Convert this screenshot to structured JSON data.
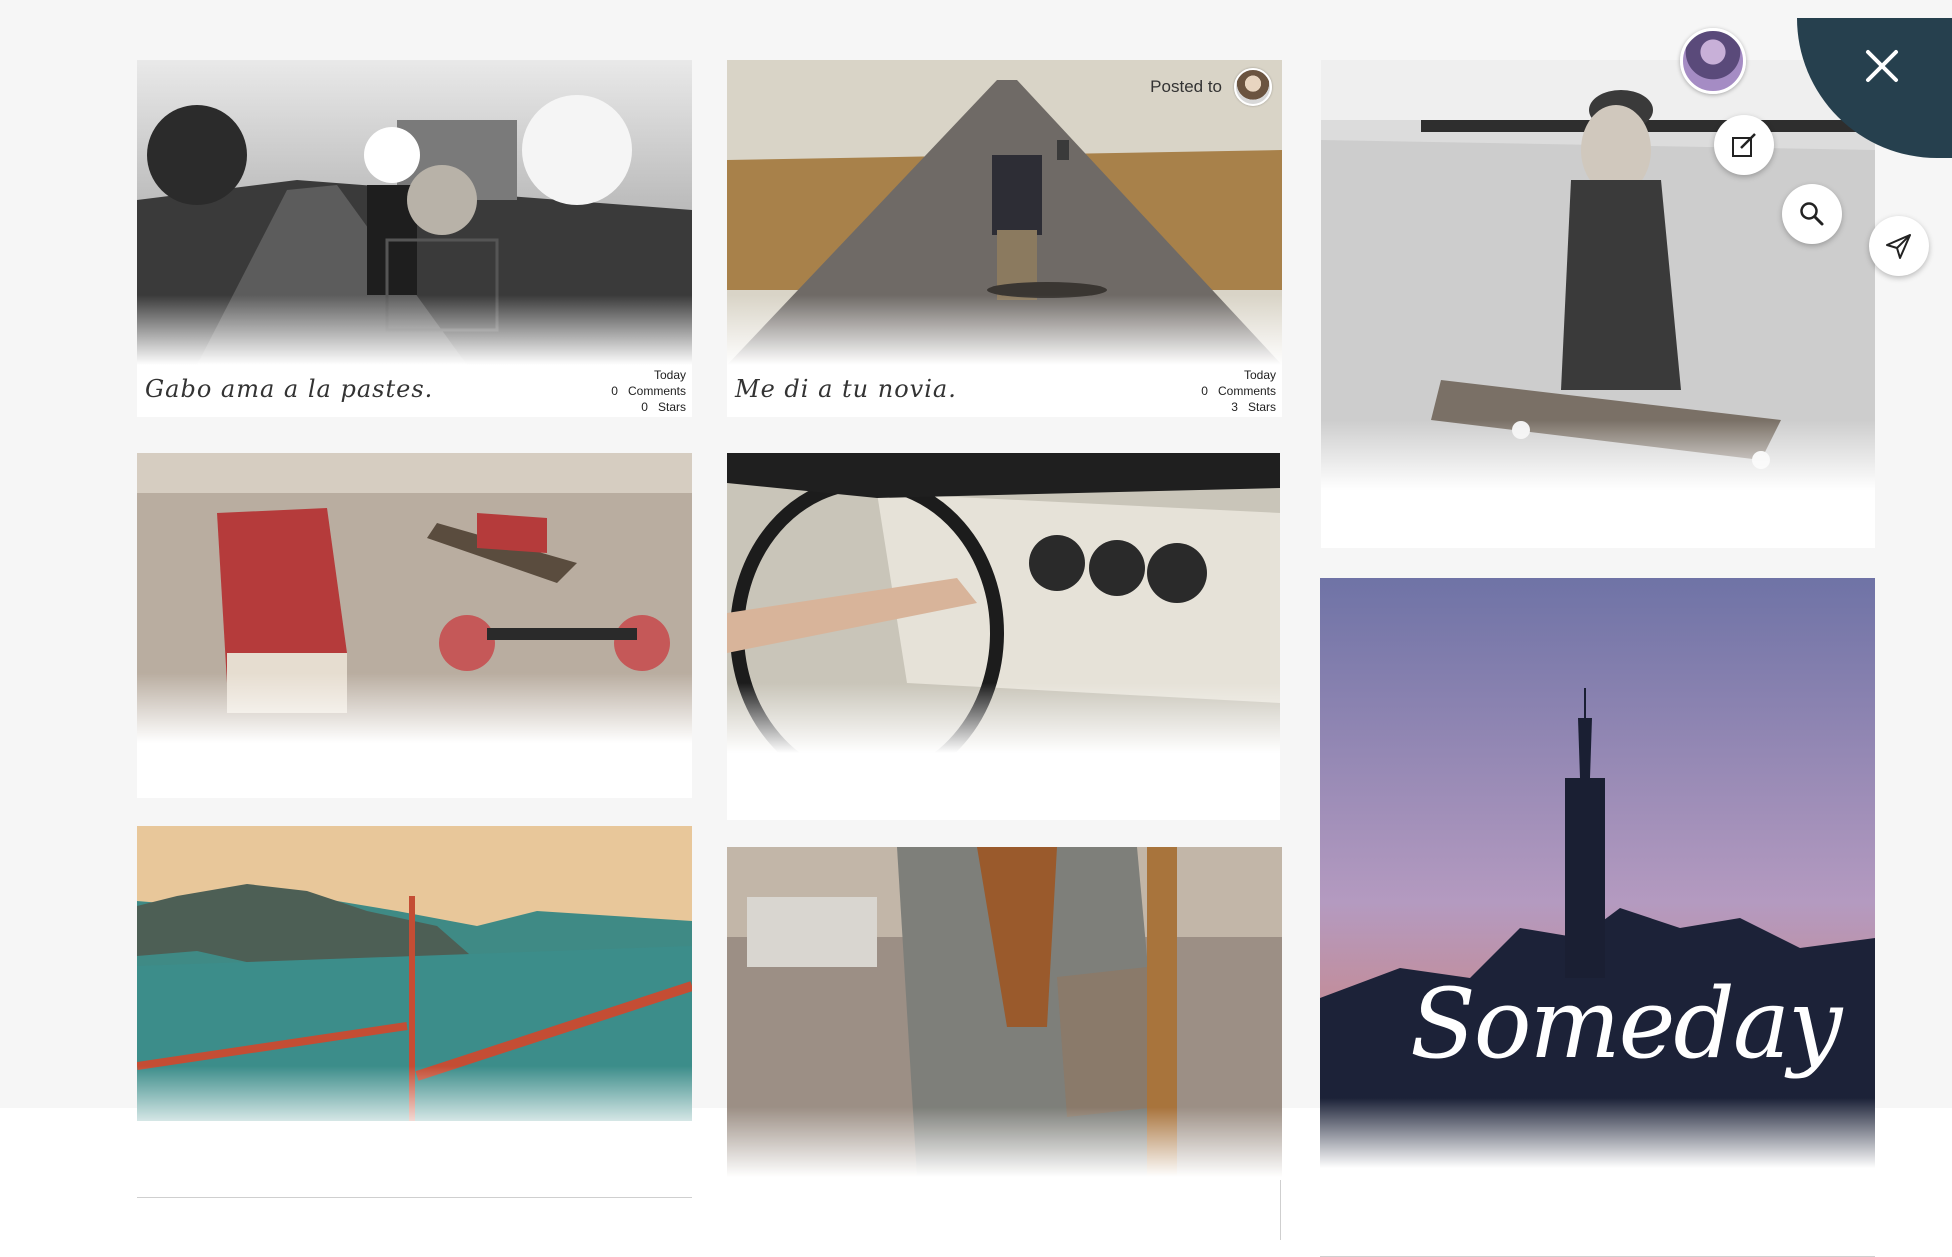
{
  "posts": [
    {
      "caption": "Gabo ama a la pastes.",
      "date": "Today",
      "comments_count": "0",
      "comments_label": "Comments",
      "stars_count": "0",
      "stars_label": "Stars"
    },
    {
      "caption": "Me di a tu novia.",
      "date": "Today",
      "comments_count": "0",
      "comments_label": "Comments",
      "stars_count": "3",
      "stars_label": "Stars",
      "posted_to_label": "Posted to"
    }
  ],
  "image_texts": {
    "skyline": "Someday"
  },
  "icons": {
    "close": "close-icon",
    "edit": "edit-icon",
    "search": "search-icon",
    "send": "send-icon"
  },
  "colors": {
    "accent": "#26404e",
    "card_bg": "#ffffff",
    "page_bg": "#f6f6f6"
  }
}
